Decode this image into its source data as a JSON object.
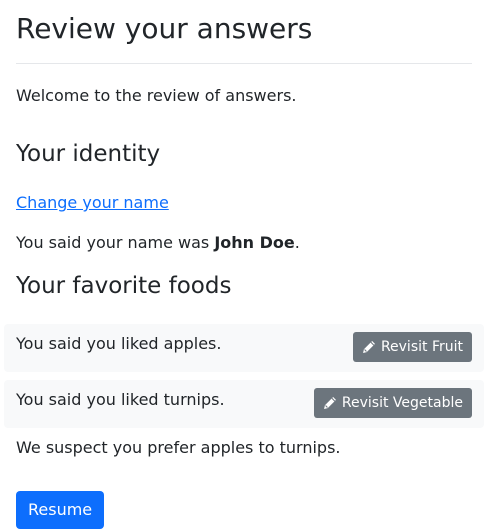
{
  "page": {
    "title": "Review your answers",
    "intro": "Welcome to the review of answers."
  },
  "identity": {
    "heading": "Your identity",
    "change_link": "Change your name",
    "name_prefix": "You said your name was ",
    "name": "John Doe",
    "name_suffix": "."
  },
  "foods": {
    "heading": "Your favorite foods",
    "rows": [
      {
        "text": "You said you liked apples.",
        "button_label": "Revisit Fruit",
        "button_icon": "pencil-icon"
      },
      {
        "text": "You said you liked turnips.",
        "button_label": "Revisit Vegetable",
        "button_icon": "pencil-icon"
      }
    ],
    "conclusion": "We suspect you prefer apples to turnips."
  },
  "actions": {
    "resume_label": "Resume"
  },
  "colors": {
    "primary": "#0d6efd",
    "secondary": "#6c757d",
    "row_background": "#f8f9fa",
    "text": "#212529"
  }
}
